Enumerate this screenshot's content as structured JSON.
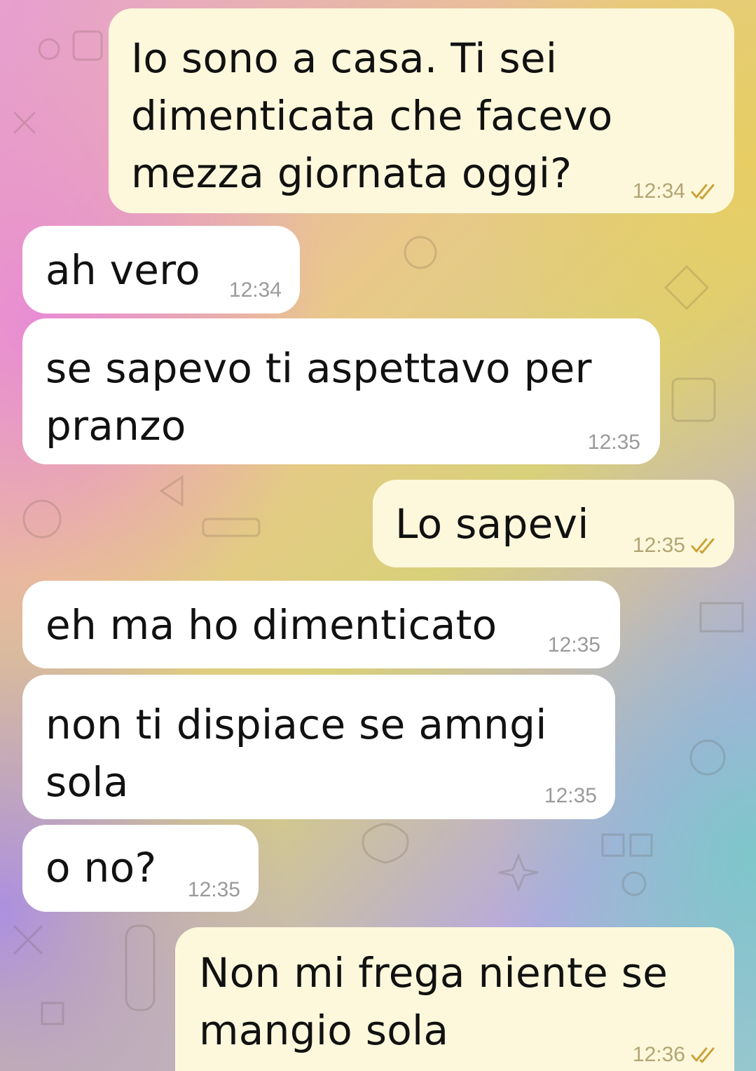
{
  "colors": {
    "incoming_bubble": "#ffffff",
    "outgoing_bubble": "#fdf8dc",
    "timestamp_in": "#9a9a9a",
    "timestamp_out": "#b3a572",
    "read_checks": "#c9a43c"
  },
  "messages": [
    {
      "direction": "outgoing",
      "text": "Io sono a casa. Ti sei\ndimenticata che facevo\nmezza giornata oggi?",
      "time": "12:34",
      "status_icon": "double-check-icon"
    },
    {
      "direction": "incoming",
      "text": "ah vero",
      "time": "12:34"
    },
    {
      "direction": "incoming",
      "text": "se sapevo ti aspettavo per\npranzo",
      "time": "12:35"
    },
    {
      "direction": "outgoing",
      "text": "Lo sapevi",
      "time": "12:35",
      "status_icon": "double-check-icon"
    },
    {
      "direction": "incoming",
      "text": "eh ma ho dimenticato",
      "time": "12:35"
    },
    {
      "direction": "incoming",
      "text": "non ti dispiace se amngi\nsola",
      "time": "12:35"
    },
    {
      "direction": "incoming",
      "text": "o no?",
      "time": "12:35"
    },
    {
      "direction": "outgoing",
      "text": "Non mi frega niente se\nmangio sola",
      "time": "12:36",
      "status_icon": "double-check-icon"
    }
  ]
}
